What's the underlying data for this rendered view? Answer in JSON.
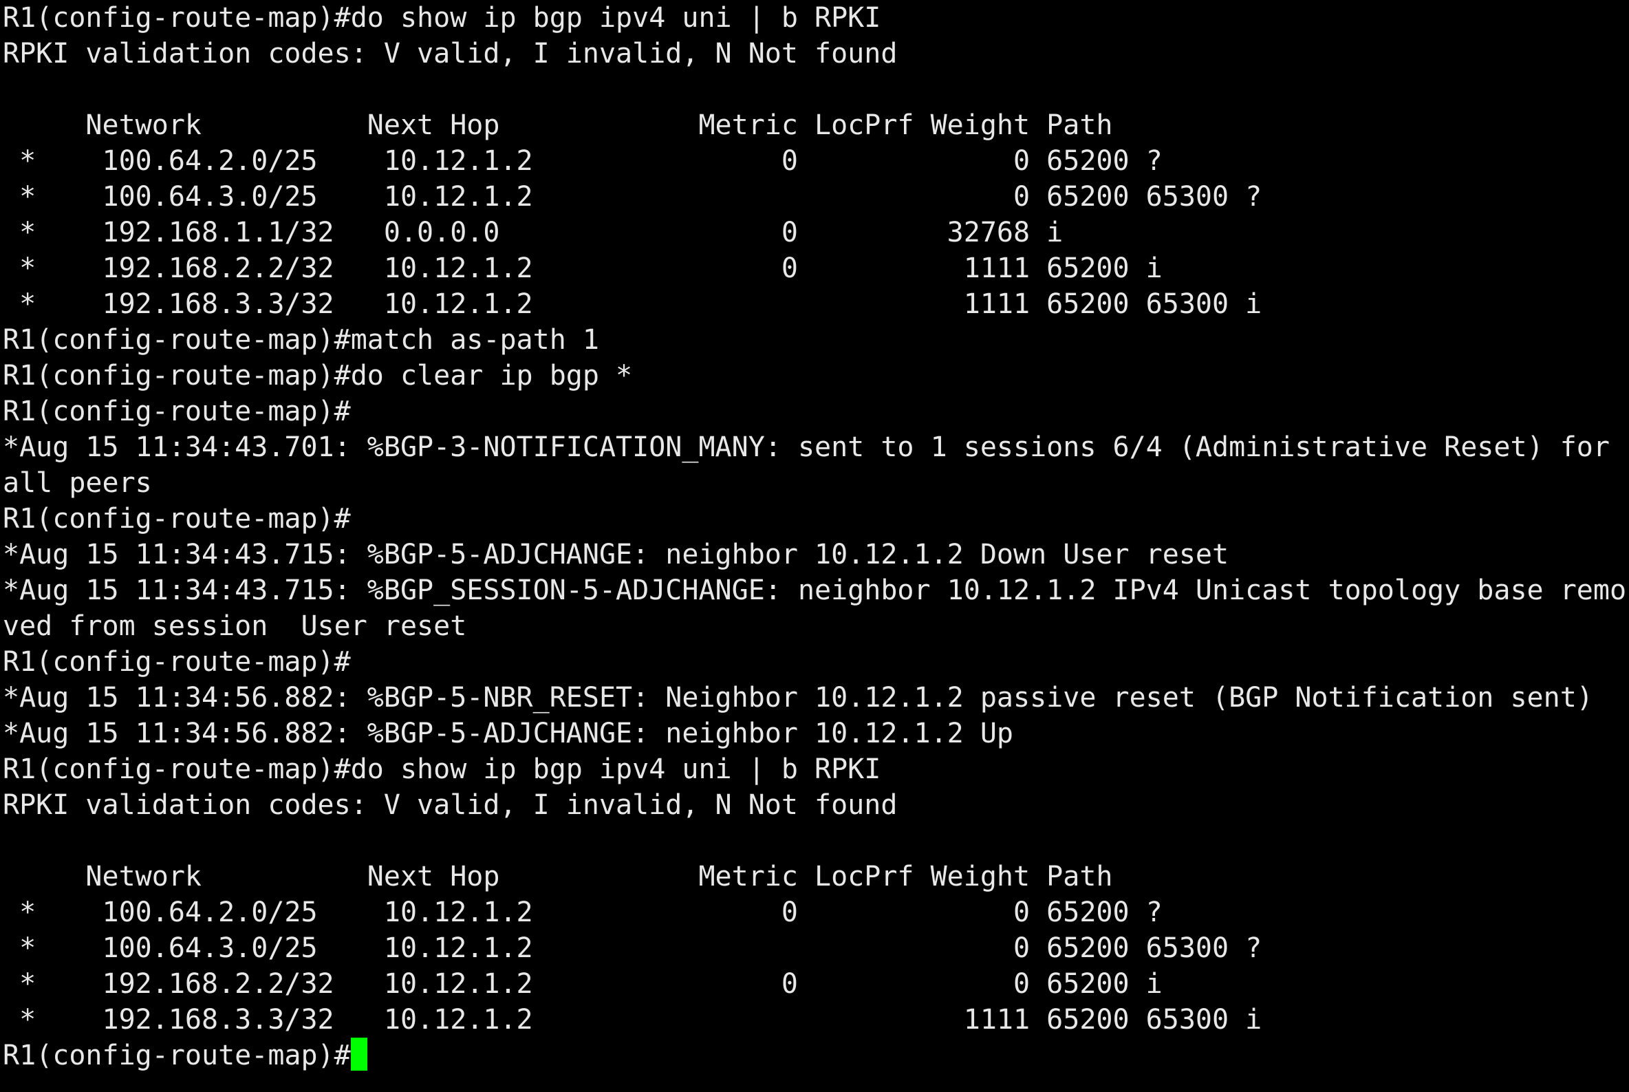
{
  "terminal": {
    "cursor_color": "#00ff00",
    "prompt": "R1(config-route-map)#",
    "lines": [
      "R1(config-route-map)#do show ip bgp ipv4 uni | b RPKI",
      "RPKI validation codes: V valid, I invalid, N Not found",
      "",
      "     Network          Next Hop            Metric LocPrf Weight Path",
      " *    100.64.2.0/25    10.12.1.2               0             0 65200 ?",
      " *    100.64.3.0/25    10.12.1.2                             0 65200 65300 ?",
      " *    192.168.1.1/32   0.0.0.0                 0         32768 i",
      " *    192.168.2.2/32   10.12.1.2               0          1111 65200 i",
      " *    192.168.3.3/32   10.12.1.2                          1111 65200 65300 i",
      "R1(config-route-map)#match as-path 1",
      "R1(config-route-map)#do clear ip bgp *",
      "R1(config-route-map)#",
      "*Aug 15 11:34:43.701: %BGP-3-NOTIFICATION_MANY: sent to 1 sessions 6/4 (Administrative Reset) for",
      "all peers",
      "R1(config-route-map)#",
      "*Aug 15 11:34:43.715: %BGP-5-ADJCHANGE: neighbor 10.12.1.2 Down User reset",
      "*Aug 15 11:34:43.715: %BGP_SESSION-5-ADJCHANGE: neighbor 10.12.1.2 IPv4 Unicast topology base remo",
      "ved from session  User reset",
      "R1(config-route-map)#",
      "*Aug 15 11:34:56.882: %BGP-5-NBR_RESET: Neighbor 10.12.1.2 passive reset (BGP Notification sent)",
      "*Aug 15 11:34:56.882: %BGP-5-ADJCHANGE: neighbor 10.12.1.2 Up",
      "R1(config-route-map)#do show ip bgp ipv4 uni | b RPKI",
      "RPKI validation codes: V valid, I invalid, N Not found",
      "",
      "     Network          Next Hop            Metric LocPrf Weight Path",
      " *    100.64.2.0/25    10.12.1.2               0             0 65200 ?",
      " *    100.64.3.0/25    10.12.1.2                             0 65200 65300 ?",
      " *    192.168.2.2/32   10.12.1.2               0             0 65200 i",
      " *    192.168.3.3/32   10.12.1.2                          1111 65200 65300 i"
    ]
  }
}
